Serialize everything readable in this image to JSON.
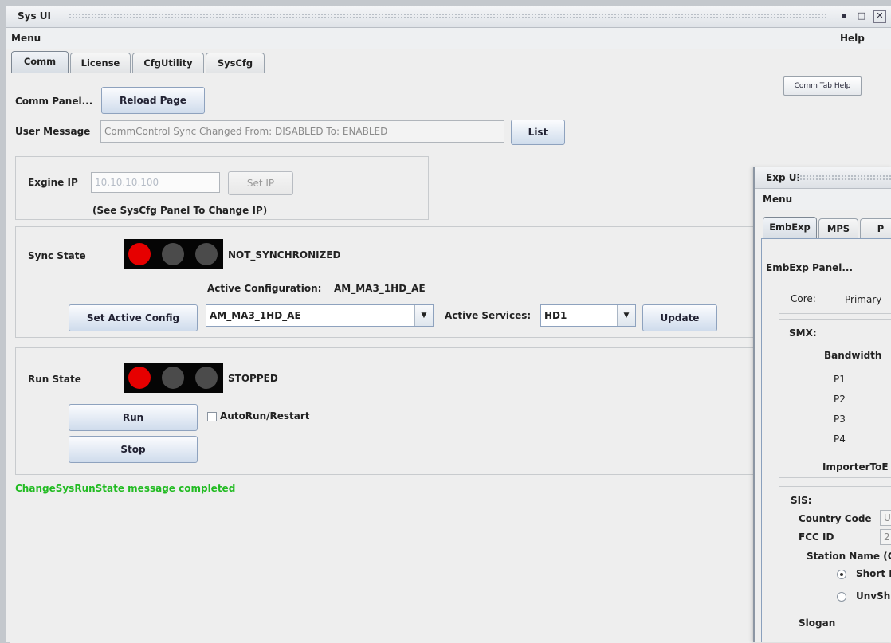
{
  "window": {
    "title": "Sys UI",
    "menu_label": "Menu",
    "help_label": "Help",
    "controls": [
      "minimize-icon",
      "maximize-icon",
      "close-icon"
    ]
  },
  "tabs": [
    "Comm",
    "License",
    "CfgUtility",
    "SysCfg"
  ],
  "selected_tab": "Comm",
  "comm": {
    "help_button": "Comm Tab Help",
    "panel_label": "Comm Panel...",
    "reload_button": "Reload Page",
    "user_message_label": "User Message",
    "user_message_value": "CommControl Sync Changed From: DISABLED To: ENABLED",
    "list_button": "List",
    "engine_ip_label": "Exgine IP",
    "engine_ip_value": "10.10.10.100",
    "set_ip_button": "Set IP",
    "ip_note": "(See SysCfg Panel To Change IP)",
    "sync_state_label": "Sync State",
    "sync_state_value": "NOT_SYNCHRONIZED",
    "active_config_label": "Active Configuration:",
    "active_config_value": "AM_MA3_1HD_AE",
    "set_active_config_button": "Set Active Config",
    "config_combo_value": "AM_MA3_1HD_AE",
    "active_services_label": "Active Services:",
    "services_combo_value": "HD1",
    "update_button": "Update",
    "run_state_label": "Run State",
    "run_state_value": "STOPPED",
    "run_button": "Run",
    "autorun_label": "AutoRun/Restart",
    "autorun_checked": false,
    "stop_button": "Stop",
    "status_message": "ChangeSysRunState message completed",
    "status_color": "#22bb22",
    "light_red_color": "#e60000"
  },
  "exp": {
    "title": "Exp UI",
    "menu_label": "Menu",
    "tabs": [
      "EmbExp",
      "MPS",
      "P"
    ],
    "selected_tab": "EmbExp",
    "panel_label": "EmbExp Panel...",
    "core_label": "Core:",
    "core_value": "Primary",
    "smx_label": "SMX:",
    "bandwidth_label": "Bandwidth",
    "p_rows": [
      "P1",
      "P2",
      "P3",
      "P4"
    ],
    "importer_label": "ImporterToE",
    "sis_label": "SIS:",
    "country_code_label": "Country Code",
    "country_code_value": "U",
    "fcc_id_label": "FCC ID",
    "fcc_id_value": "2",
    "station_name_label": "Station Name (C",
    "short_label": "Short I",
    "short_selected": true,
    "unvsh_label": "UnvSh",
    "slogan_label": "Slogan"
  }
}
